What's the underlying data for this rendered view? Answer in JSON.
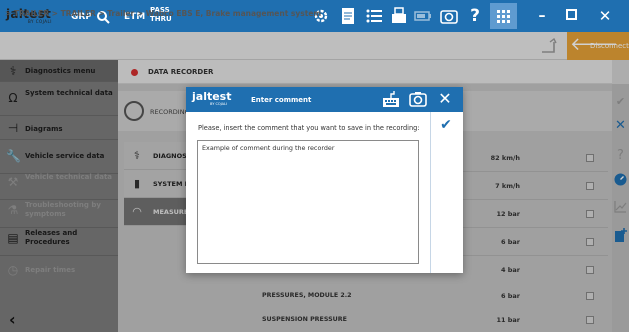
{
  "topbar": {
    "logo": "jaltest",
    "logo_sub": "BY COJALI",
    "mode": "GRP",
    "etm": "ETM",
    "pass_thru_line1": "PASS",
    "pass_thru_line2": "THRU",
    "icons": [
      "settings-gear-icon",
      "document-icon",
      "list-icon",
      "printer-icon",
      "battery-icon",
      "camera-icon",
      "help-icon",
      "grid-menu-icon"
    ],
    "window_controls": [
      "minimize",
      "maximize",
      "close"
    ]
  },
  "breadcrumb": {
    "text": "> TRAILER > TRAILER > Trailer > Wabco EBS E, Brake management system",
    "disconnect_label": "Disconnect"
  },
  "sidebar": {
    "items": [
      {
        "label": "Diagnostics menu",
        "icon": "diagnostics-icon",
        "state": "active"
      },
      {
        "label": "System technical data",
        "icon": "omega-icon",
        "state": "normal"
      },
      {
        "label": "Diagrams",
        "icon": "diagram-icon",
        "state": "normal"
      },
      {
        "label": "Vehicle service data",
        "icon": "wrench-icon",
        "state": "normal"
      },
      {
        "label": "Vehicle technical data",
        "icon": "tools-icon",
        "state": "disabled"
      },
      {
        "label": "Troubleshooting by symptoms",
        "icon": "symptoms-icon",
        "state": "disabled"
      },
      {
        "label": "Releases and Procedures",
        "icon": "releases-icon",
        "state": "normal"
      },
      {
        "label": "Repair times",
        "icon": "clock-icon",
        "state": "disabled"
      }
    ]
  },
  "header": {
    "title": "DATA RECORDER"
  },
  "recording": {
    "label": "RECORDING"
  },
  "menu": {
    "items": [
      {
        "label": "DIAGNOSIS",
        "icon": "diagnosis-icon"
      },
      {
        "label": "SYSTEM DATA",
        "icon": "system-data-icon"
      },
      {
        "label": "MEASURES",
        "icon": "measures-icon"
      }
    ]
  },
  "data_rows": [
    {
      "name": "",
      "value": "82 km/h"
    },
    {
      "name": "",
      "value": "7 km/h"
    },
    {
      "name": "",
      "value": "12 bar"
    },
    {
      "name": "",
      "value": "6 bar"
    },
    {
      "name": "",
      "value": "4 bar"
    },
    {
      "name": "PRESSURES, MODULE 2.2",
      "value": "6 bar"
    },
    {
      "name": "SUSPENSION PRESSURE",
      "value": "11 bar"
    }
  ],
  "dialog": {
    "logo": "jaltest",
    "logo_sub": "BY COJALI",
    "title": "Enter comment",
    "prompt": "Please, insert the comment that you want to save in the recording:",
    "comment_value": "Example of comment during the recorder"
  },
  "colors": {
    "brand_blue": "#1f6fb0",
    "disconnect_orange": "#e6a237",
    "record_red": "#d32f2f"
  }
}
